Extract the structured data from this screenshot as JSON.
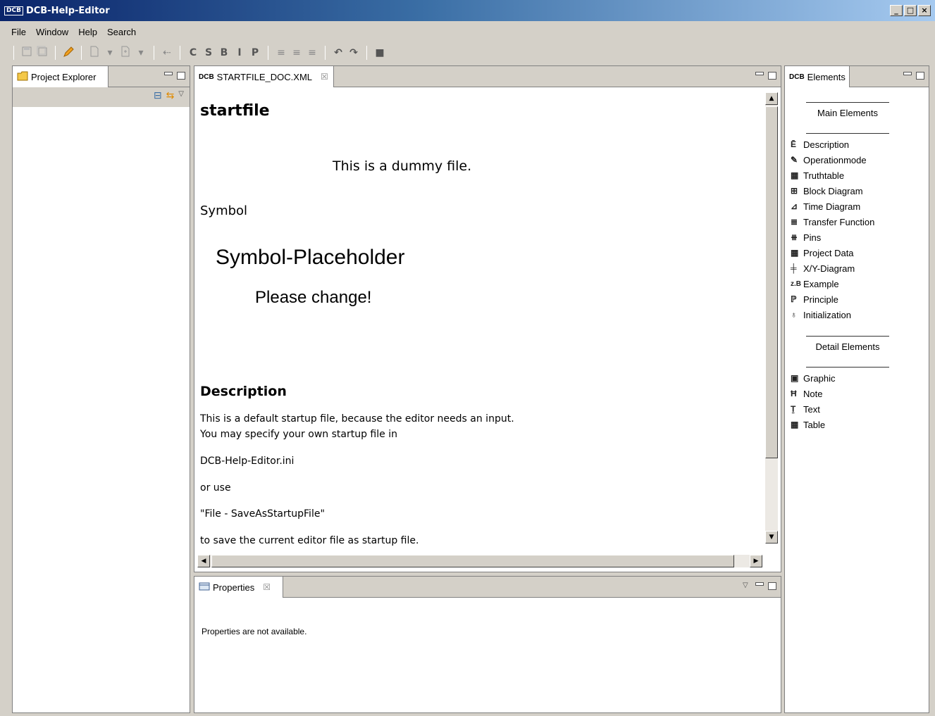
{
  "window": {
    "icon": "DCB",
    "title": "DCB-Help-Editor",
    "buttons": [
      "_",
      "□",
      "×"
    ]
  },
  "menubar": [
    "File",
    "Window",
    "Help",
    "Search"
  ],
  "toolbar": {
    "icons": [
      "save-icon",
      "save-all-icon",
      "pencil-icon",
      "new-file-icon",
      "new-file-dropdown",
      "insert-icon",
      "insert-dropdown",
      "back-icon"
    ],
    "format": [
      "C",
      "S",
      "B",
      "I",
      "P"
    ],
    "list_glyphs": [
      "≡",
      "≡",
      "≡"
    ],
    "undo": "↶",
    "redo": "↷",
    "stop": "■"
  },
  "project_explorer": {
    "tab_label": "Project Explorer"
  },
  "editor": {
    "tab_icon": "DCB",
    "tab_label": "STARTFILE_DOC.XML",
    "title": "startfile",
    "dummy_text": "This is a dummy file.",
    "symbol_heading": "Symbol",
    "symbol_placeholder": "Symbol-Placeholder",
    "symbol_change": "Please change!",
    "description_heading": "Description",
    "lines": [
      "This is a default startup file, because the editor needs an input.",
      "You may specify your own startup file in",
      "DCB-Help-Editor.ini",
      "or use",
      "\"File - SaveAsStartupFile\"",
      "to save the current editor file as startup file."
    ]
  },
  "elements": {
    "tab_icon": "DCB",
    "tab_label": "Elements",
    "main_heading": "Main Elements",
    "main_items": [
      {
        "icon": "Ē",
        "label": "Description"
      },
      {
        "icon": "✎",
        "label": "Operationmode"
      },
      {
        "icon": "▦",
        "label": "Truthtable"
      },
      {
        "icon": "⊞",
        "label": "Block Diagram"
      },
      {
        "icon": "⊿",
        "label": "Time Diagram"
      },
      {
        "icon": "≣",
        "label": "Transfer Function"
      },
      {
        "icon": "⧻",
        "label": "Pins"
      },
      {
        "icon": "▦",
        "label": "Project Data"
      },
      {
        "icon": "╪",
        "label": "X/Y-Diagram"
      },
      {
        "icon": "z.B",
        "label": "Example"
      },
      {
        "icon": "ℙ",
        "label": "Principle"
      },
      {
        "icon": "♁",
        "label": "Initialization"
      }
    ],
    "detail_heading": "Detail Elements",
    "detail_items": [
      {
        "icon": "▣",
        "label": "Graphic"
      },
      {
        "icon": "Ħ",
        "label": "Note"
      },
      {
        "icon": "Ṯ",
        "label": "Text"
      },
      {
        "icon": "▦",
        "label": "Table"
      }
    ]
  },
  "properties": {
    "tab_label": "Properties",
    "message": "Properties are not available."
  }
}
